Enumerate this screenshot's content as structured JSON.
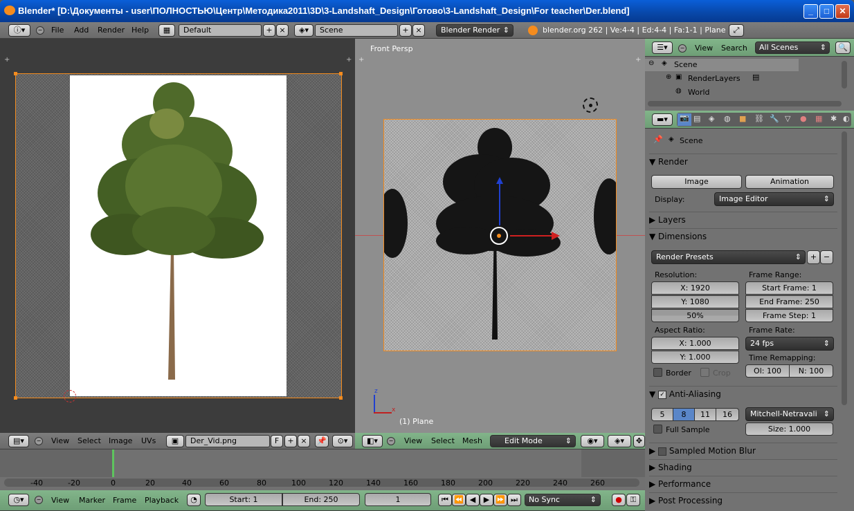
{
  "window": {
    "title": "Blender* [D:\\Документы - user\\ПОЛНОСТЬЮ\\Центр\\Методика2011\\3D\\3-Landshaft_Design\\Готово\\3-Landshaft_Design\\For teacher\\Der.blend]"
  },
  "info_header": {
    "menu": [
      "File",
      "Add",
      "Render",
      "Help"
    ],
    "screen_layout": "Default",
    "scene": "Scene",
    "engine": "Blender Render",
    "stats": "blender.org 262 | Ve:4-4 | Ed:4-4 | Fa:1-1 | Plane"
  },
  "uv_editor": {
    "menu": [
      "View",
      "Select",
      "Image",
      "UVs"
    ],
    "image_name": "Der_Vid.png",
    "fake_user": "F"
  },
  "viewport": {
    "view_label": "Front Persp",
    "object_label": "(1) Plane",
    "menu": [
      "View",
      "Select",
      "Mesh"
    ],
    "mode": "Edit Mode",
    "axis_x": "x",
    "axis_z": "z"
  },
  "outliner": {
    "menu": [
      "View",
      "Search"
    ],
    "scenes_select": "All Scenes",
    "tree": [
      "Scene",
      "RenderLayers",
      "World"
    ]
  },
  "properties": {
    "context": "Scene",
    "render_title": "Render",
    "image_button": "Image",
    "animation_button": "Animation",
    "display_label": "Display:",
    "display_value": "Image Editor",
    "layers": "Layers",
    "dimensions": "Dimensions",
    "render_presets": "Render Presets",
    "resolution_label": "Resolution:",
    "res_x": "X: 1920",
    "res_y": "Y: 1080",
    "res_pct": "50%",
    "frame_range_label": "Frame Range:",
    "start_frame": "Start Frame: 1",
    "end_frame": "End Frame: 250",
    "frame_step": "Frame Step: 1",
    "aspect_label": "Aspect Ratio:",
    "asp_x": "X: 1.000",
    "asp_y": "Y: 1.000",
    "frame_rate_label": "Frame Rate:",
    "frame_rate": "24 fps",
    "border": "Border",
    "crop": "Crop",
    "time_remap_label": "Time Remapping:",
    "remap_old": "Ol: 100",
    "remap_new": "N: 100",
    "anti_aliasing": "Anti-Aliasing",
    "aa_samples": [
      "5",
      "8",
      "11",
      "16"
    ],
    "aa_selected": "8",
    "aa_filter": "Mitchell-Netravali",
    "full_sample": "Full Sample",
    "filter_size": "Size: 1.000",
    "sampled_motion_blur": "Sampled Motion Blur",
    "shading": "Shading",
    "performance": "Performance",
    "post_processing": "Post Processing"
  },
  "timeline": {
    "ticks": [
      "-40",
      "-20",
      "0",
      "20",
      "40",
      "60",
      "80",
      "100",
      "120",
      "140",
      "160",
      "180",
      "200",
      "220",
      "240",
      "260"
    ],
    "menu": [
      "View",
      "Marker",
      "Frame",
      "Playback"
    ],
    "start": "Start: 1",
    "end": "End: 250",
    "current": "1",
    "sync": "No Sync"
  },
  "colors": {
    "accent_orange": "#f58c1e",
    "header_green": "#7aab83",
    "selection_blue": "#5a86c8"
  }
}
